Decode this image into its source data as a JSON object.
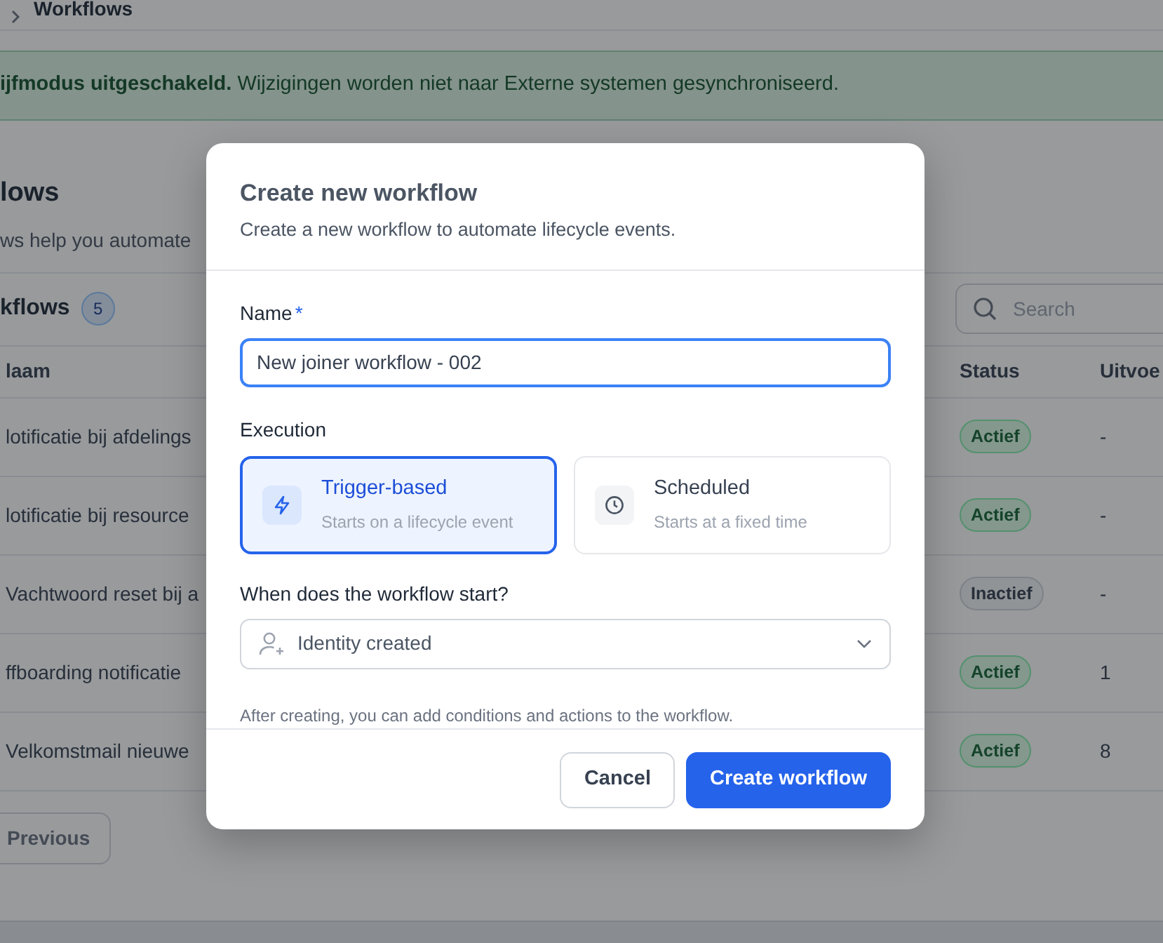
{
  "breadcrumb": {
    "label": "Workflows"
  },
  "alert": {
    "text": "**ijfmodus uitgeschakeld.** Wijzigingen worden niet naar Externe systemen gesynchroniseerd."
  },
  "page": {
    "title": "lows",
    "subtitle": "ws help you automate"
  },
  "list": {
    "title": "kflows",
    "count": "5",
    "search": {
      "placeholder": "Search"
    },
    "columns": [
      "laam",
      "Status",
      "Uitvoe"
    ],
    "rows": [
      {
        "name": "lotificatie bij afdelings",
        "status": "Actief",
        "active": true,
        "runs": "-"
      },
      {
        "name": "lotificatie bij resource",
        "status": "Actief",
        "active": true,
        "runs": "-"
      },
      {
        "name": "Vachtwoord reset bij a",
        "status": "Inactief",
        "active": false,
        "runs": "-"
      },
      {
        "name": "ffboarding notificatie",
        "status": "Actief",
        "active": true,
        "runs": "1"
      },
      {
        "name": "Velkomstmail nieuwe",
        "status": "Actief",
        "active": true,
        "runs": "8"
      }
    ]
  },
  "pagination": {
    "previous": "Previous"
  },
  "modal": {
    "title": "Create new workflow",
    "subtitle": "Create a new workflow to automate lifecycle events.",
    "name": {
      "label": "Name",
      "required_mark": "*",
      "value": "New joiner workflow - 002"
    },
    "execution": {
      "label": "Execution",
      "options": [
        {
          "kind": "trigger",
          "title": "Trigger-based",
          "description": "Starts on a lifecycle event",
          "selected": true
        },
        {
          "kind": "schedule",
          "title": "Scheduled",
          "description": "Starts at a fixed time",
          "selected": false
        }
      ]
    },
    "start": {
      "label": "When does the workflow start?",
      "value": "Identity created"
    },
    "hint": "After creating, you can add conditions and actions to the workflow.",
    "buttons": [
      {
        "label": "Cancel",
        "kind": "secondary"
      },
      {
        "label": "Create workflow",
        "kind": "primary"
      }
    ]
  }
}
